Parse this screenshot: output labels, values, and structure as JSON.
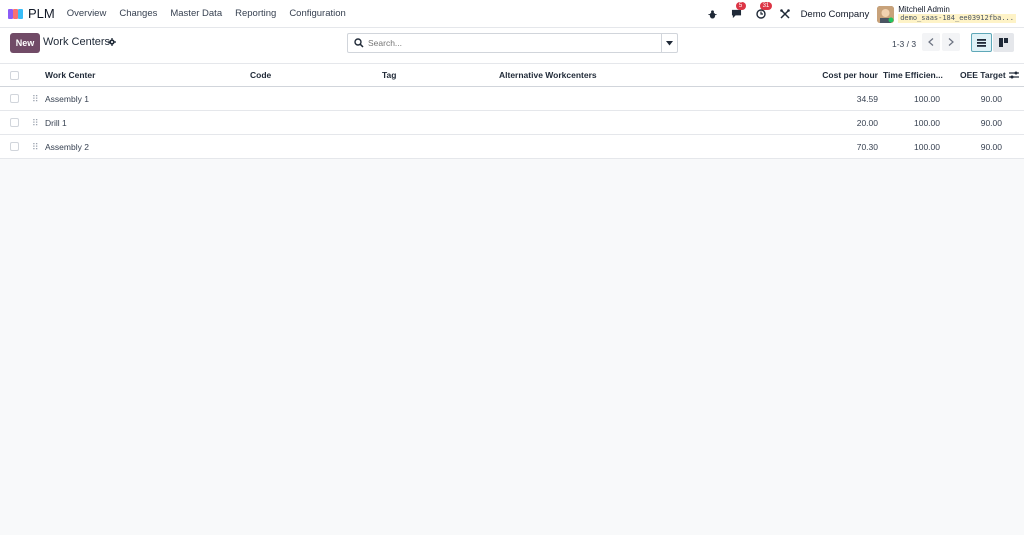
{
  "navbar": {
    "app_name": "PLM",
    "menu": [
      "Overview",
      "Changes",
      "Master Data",
      "Reporting",
      "Configuration"
    ],
    "messages_count": "5",
    "activities_count": "31",
    "company": "Demo Company",
    "user_name": "Mitchell Admin",
    "db_name": "demo_saas-184_ee03912fba..."
  },
  "control": {
    "new_label": "New",
    "title": "Work Centers",
    "search_placeholder": "Search...",
    "pager": "1-3 / 3"
  },
  "table": {
    "headers": {
      "work_center": "Work Center",
      "code": "Code",
      "tag": "Tag",
      "alt": "Alternative Workcenters",
      "cost": "Cost per hour",
      "time_eff": "Time Efficien...",
      "oee": "OEE Target"
    },
    "rows": [
      {
        "name": "Assembly 1",
        "code": "",
        "tag": "",
        "alt": "",
        "cost": "34.59",
        "eff": "100.00",
        "oee": "90.00"
      },
      {
        "name": "Drill 1",
        "code": "",
        "tag": "",
        "alt": "",
        "cost": "20.00",
        "eff": "100.00",
        "oee": "90.00"
      },
      {
        "name": "Assembly 2",
        "code": "",
        "tag": "",
        "alt": "",
        "cost": "70.30",
        "eff": "100.00",
        "oee": "90.00"
      }
    ]
  },
  "colors": {
    "primary": "#714b67",
    "badge": "#dc3545"
  }
}
